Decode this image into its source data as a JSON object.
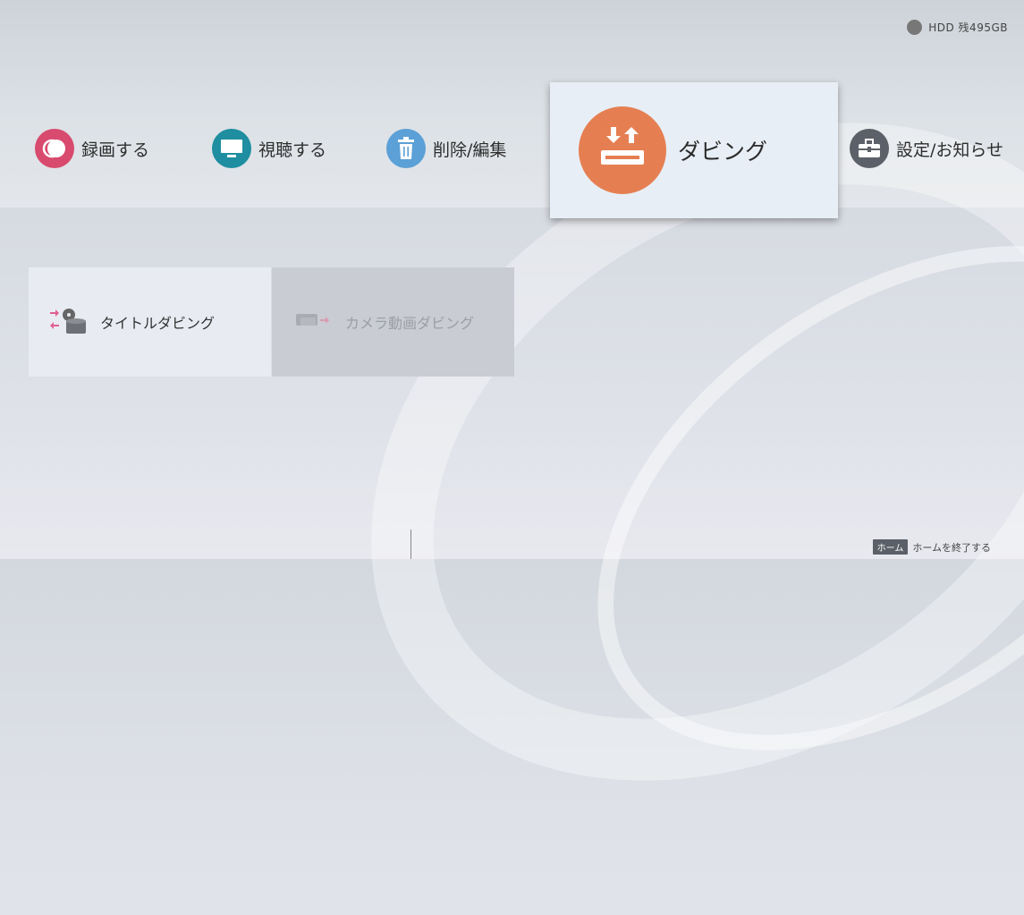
{
  "status": {
    "storage": "HDD 残495GB"
  },
  "menu": {
    "items": [
      {
        "label": "録画する",
        "icon": "record-icon",
        "color": "#d84b6e"
      },
      {
        "label": "視聴する",
        "icon": "tv-icon",
        "color": "#1e8ea0"
      },
      {
        "label": "削除/編集",
        "icon": "trash-icon",
        "color": "#5ba0d6"
      },
      {
        "label": "ダビング",
        "icon": "dubbing-icon",
        "color": "#e57f52",
        "selected": true
      },
      {
        "label": "設定/お知らせ",
        "icon": "toolbox-icon",
        "color": "#5c6068"
      }
    ]
  },
  "submenu": {
    "items": [
      {
        "label": "タイトルダビング",
        "icon": "title-dubbing-icon",
        "enabled": true
      },
      {
        "label": "カメラ動画ダビング",
        "icon": "camera-dubbing-icon",
        "enabled": false
      }
    ]
  },
  "footer": {
    "key": "ホーム",
    "text": "ホームを終了する"
  }
}
